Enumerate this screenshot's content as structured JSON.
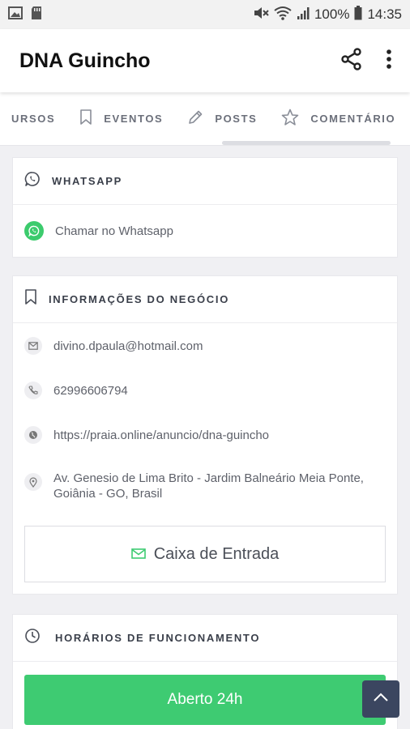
{
  "status_bar": {
    "battery_pct": "100%",
    "time": "14:35",
    "icons": [
      "image-icon",
      "sd-card-icon",
      "mute-icon",
      "wifi-icon",
      "signal-icon",
      "battery-icon"
    ]
  },
  "app_bar": {
    "title": "DNA Guincho",
    "actions": [
      "share-icon",
      "more-vert-icon"
    ]
  },
  "tabs": [
    {
      "label": "URSOS",
      "icon": ""
    },
    {
      "label": "EVENTOS",
      "icon": "bookmark-icon"
    },
    {
      "label": "POSTS",
      "icon": "pencil-icon"
    },
    {
      "label": "COMENTÁRIO",
      "icon": "star-icon"
    }
  ],
  "whatsapp_card": {
    "title": "WHATSAPP",
    "action_label": "Chamar no Whatsapp"
  },
  "business_card": {
    "title": "INFORMAÇÕES DO NEGÓCIO",
    "email": "divino.dpaula@hotmail.com",
    "phone": "62996606794",
    "website": "https://praia.online/anuncio/dna-guincho",
    "address_line1": "Av. Genesio de Lima Brito - Jardim Balneário Meia Ponte,",
    "address_line2": "Goiânia - GO, Brasil",
    "inbox_label": "Caixa de Entrada"
  },
  "hours_card": {
    "title": "HORÁRIOS DE FUNCIONAMENTO",
    "status_label": "Aberto 24h"
  },
  "colors": {
    "accent_green": "#3ecb72",
    "scroll_top_bg": "#3b4660"
  }
}
